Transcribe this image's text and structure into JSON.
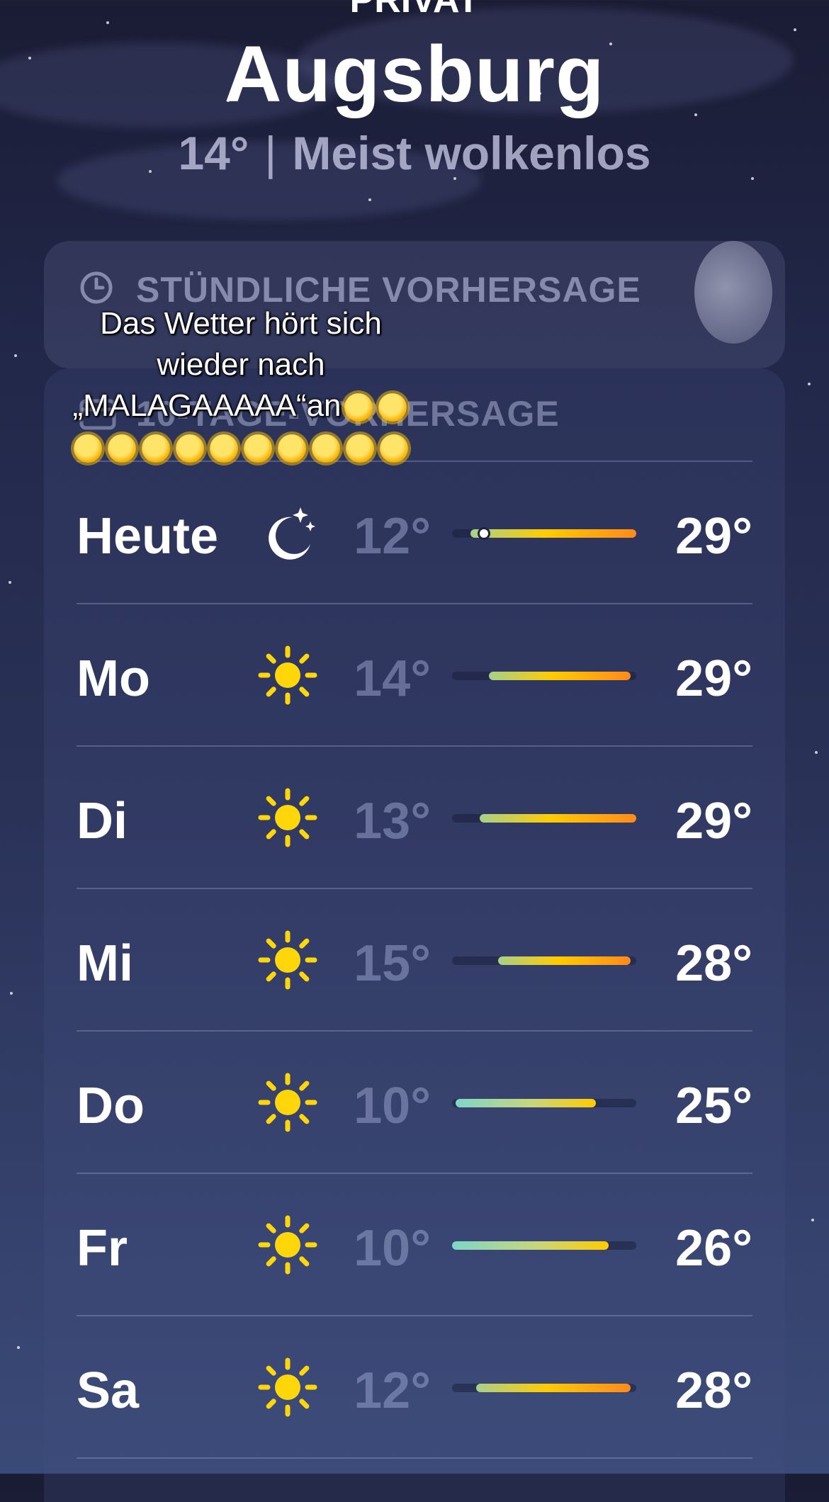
{
  "header": {
    "privat": "PRIVAT",
    "city": "Augsburg",
    "current_temp": "14°",
    "separator": "|",
    "condition": "Meist wolkenlos"
  },
  "hourly": {
    "title": "STÜNDLICHE VORHERSAGE",
    "icon": "clock-icon"
  },
  "daily": {
    "title": "10-TAGE-VORHERSAGE",
    "icon": "calendar-icon"
  },
  "sticker": {
    "line1": "Das Wetter hört sich",
    "line2": "wieder nach",
    "line3": "„MALAGAAAAA“an",
    "sun_count_line3": 2,
    "sun_count_line4": 10
  },
  "colors": {
    "sun": "#ffd60a",
    "moon": "#ffffff",
    "bar_cool": "#7fd6c8",
    "bar_warm": "#ffcc00",
    "bar_hot": "#ff8a1a"
  },
  "forecast": [
    {
      "day": "Heute",
      "icon": "moon-stars-icon",
      "low": "12°",
      "high": "29°",
      "bar_start": 0.1,
      "bar_end": 1.0,
      "current": 0.16
    },
    {
      "day": "Mo",
      "icon": "sun-icon",
      "low": "14°",
      "high": "29°",
      "bar_start": 0.2,
      "bar_end": 0.97
    },
    {
      "day": "Di",
      "icon": "sun-icon",
      "low": "13°",
      "high": "29°",
      "bar_start": 0.15,
      "bar_end": 1.0
    },
    {
      "day": "Mi",
      "icon": "sun-icon",
      "low": "15°",
      "high": "28°",
      "bar_start": 0.25,
      "bar_end": 0.97
    },
    {
      "day": "Do",
      "icon": "sun-icon",
      "low": "10°",
      "high": "25°",
      "bar_start": 0.02,
      "bar_end": 0.78
    },
    {
      "day": "Fr",
      "icon": "sun-icon",
      "low": "10°",
      "high": "26°",
      "bar_start": 0.0,
      "bar_end": 0.85
    },
    {
      "day": "Sa",
      "icon": "sun-icon",
      "low": "12°",
      "high": "28°",
      "bar_start": 0.13,
      "bar_end": 0.97
    }
  ]
}
